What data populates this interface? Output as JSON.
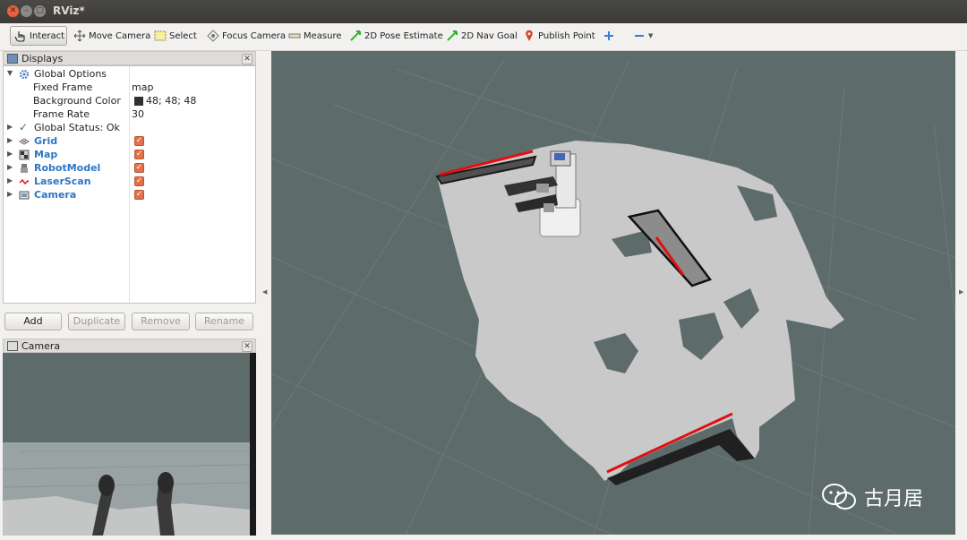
{
  "window": {
    "title": "RViz*"
  },
  "toolbar": {
    "tools": [
      {
        "label": "Interact",
        "icon": "hand-cursor-icon"
      },
      {
        "label": "Move Camera",
        "icon": "move-arrows-icon"
      },
      {
        "label": "Select",
        "icon": "select-box-icon"
      },
      {
        "label": "Focus Camera",
        "icon": "focus-target-icon"
      },
      {
        "label": "Measure",
        "icon": "ruler-icon"
      },
      {
        "label": "2D Pose Estimate",
        "icon": "green-arrow-icon"
      },
      {
        "label": "2D Nav Goal",
        "icon": "green-arrow-icon"
      },
      {
        "label": "Publish Point",
        "icon": "map-pin-icon"
      }
    ]
  },
  "displays": {
    "title": "Displays",
    "global_options": {
      "label": "Global Options",
      "fixed_frame": {
        "label": "Fixed Frame",
        "value": "map"
      },
      "background_color": {
        "label": "Background Color",
        "value": "48; 48; 48"
      },
      "frame_rate": {
        "label": "Frame Rate",
        "value": "30"
      }
    },
    "global_status": "Global Status: Ok",
    "items": [
      {
        "label": "Grid",
        "checked": true
      },
      {
        "label": "Map",
        "checked": true
      },
      {
        "label": "RobotModel",
        "checked": true
      },
      {
        "label": "LaserScan",
        "checked": true
      },
      {
        "label": "Camera",
        "checked": true
      }
    ],
    "buttons": {
      "add": "Add",
      "duplicate": "Duplicate",
      "remove": "Remove",
      "rename": "Rename"
    }
  },
  "camera_panel": {
    "title": "Camera"
  },
  "watermark": {
    "text": "古月居"
  },
  "colors": {
    "viewport_bg": "#5e6b6b",
    "map_free": "#c9c9c9",
    "laser": "#e01010",
    "checkbox": "#e3714a"
  }
}
